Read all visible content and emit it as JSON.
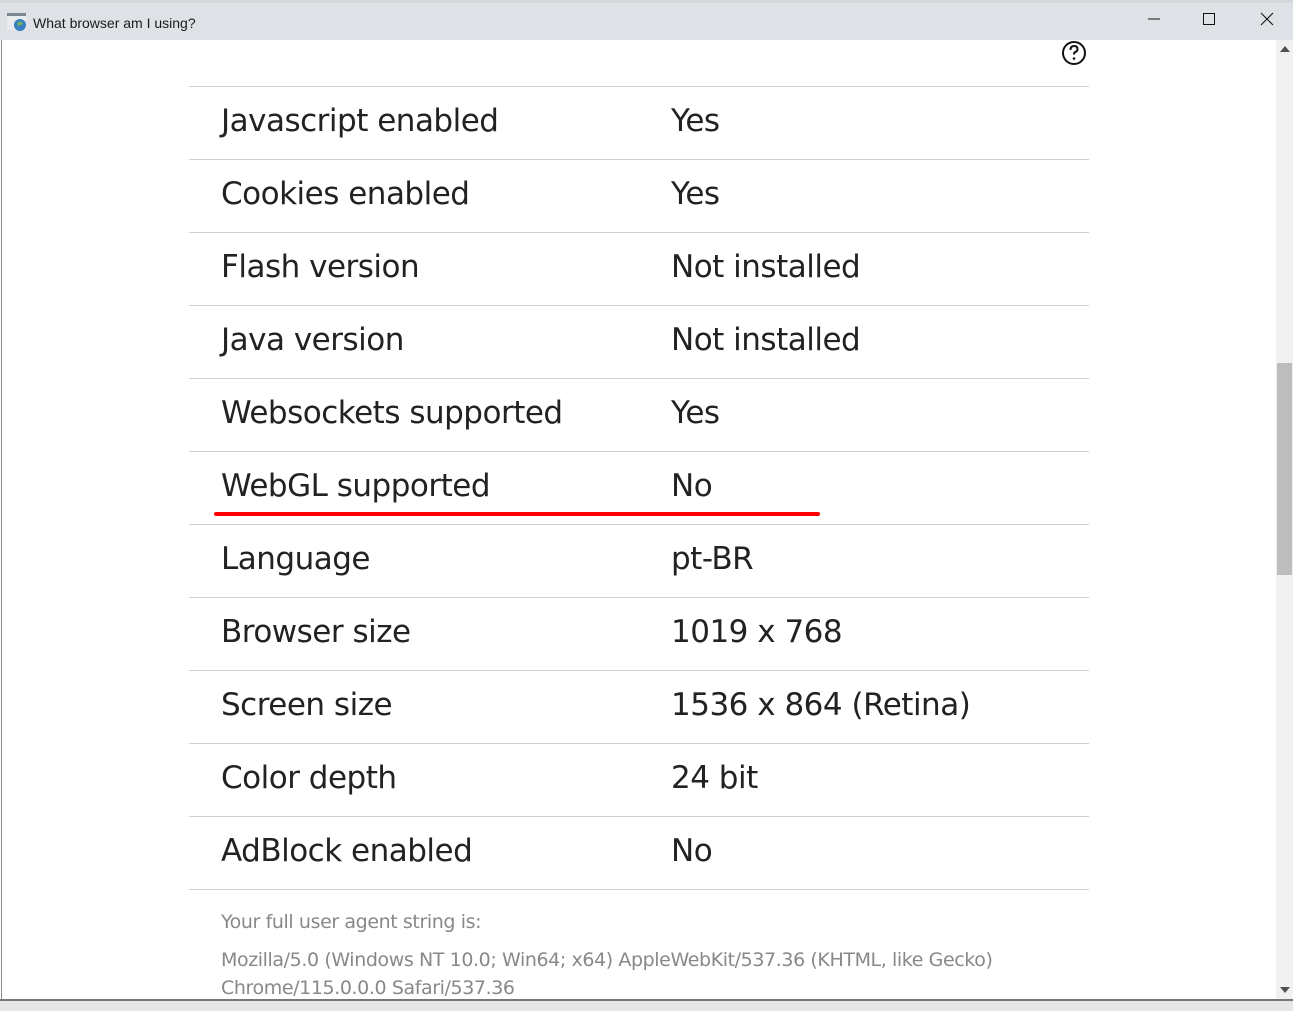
{
  "window": {
    "title": "What browser am I using?",
    "controls": {
      "minimize": "minimize",
      "maximize": "maximize",
      "close": "close"
    }
  },
  "help_icon": "question-circle-icon",
  "rows": [
    {
      "label": "Javascript enabled",
      "value": "Yes"
    },
    {
      "label": "Cookies enabled",
      "value": "Yes"
    },
    {
      "label": "Flash version",
      "value": "Not installed"
    },
    {
      "label": "Java version",
      "value": "Not installed"
    },
    {
      "label": "Websockets supported",
      "value": "Yes"
    },
    {
      "label": "WebGL supported",
      "value": "No"
    },
    {
      "label": "Language",
      "value": "pt-BR"
    },
    {
      "label": "Browser size",
      "value": "1019 x 768"
    },
    {
      "label": "Screen size",
      "value": "1536 x 864 (Retina)"
    },
    {
      "label": "Color depth",
      "value": "24 bit"
    },
    {
      "label": "AdBlock enabled",
      "value": "No"
    }
  ],
  "highlighted_row": "WebGL supported",
  "highlight_color": "#ff0000",
  "user_agent": {
    "label": "Your full user agent string is:",
    "value": "Mozilla/5.0 (Windows NT 10.0; Win64; x64) AppleWebKit/537.36 (KHTML, like Gecko) Chrome/115.0.0.0 Safari/537.36"
  }
}
